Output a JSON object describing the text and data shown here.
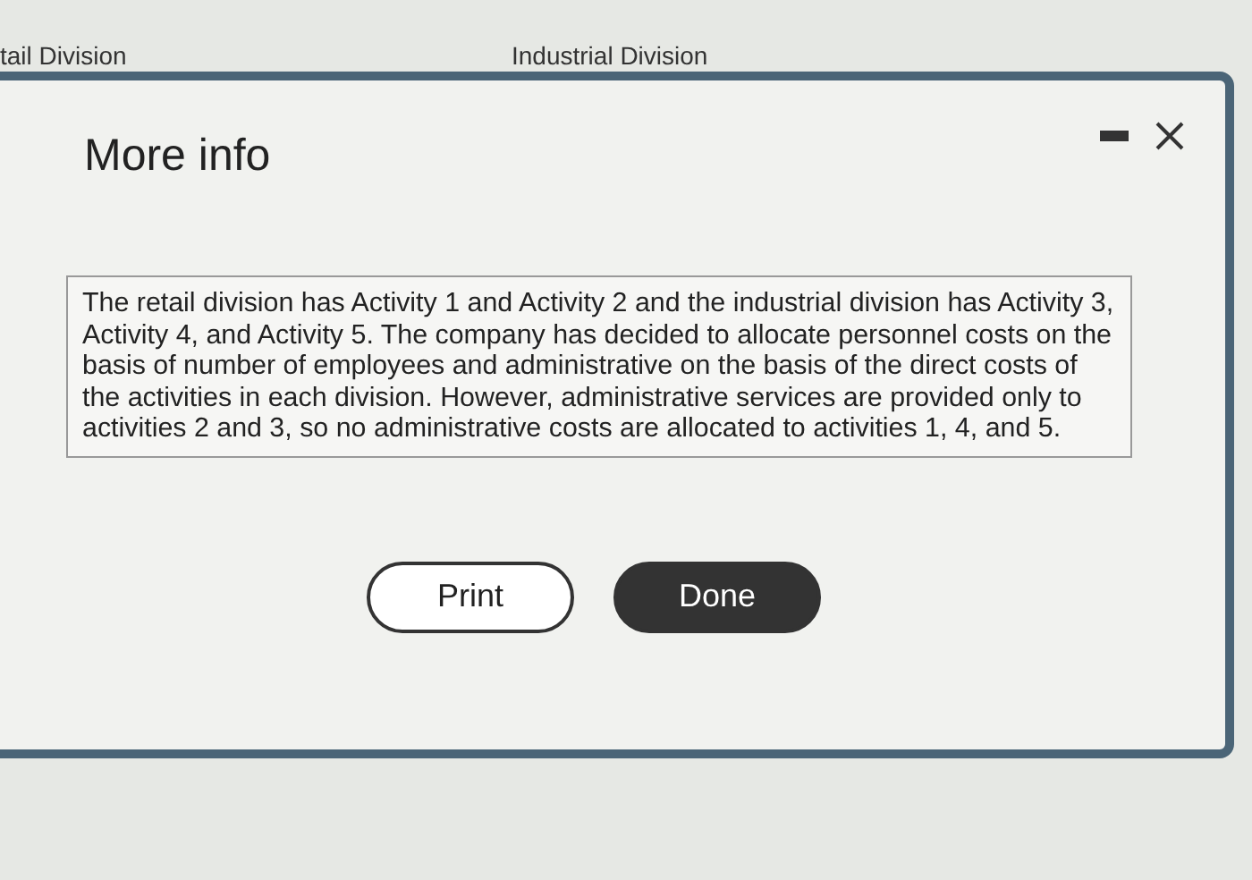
{
  "background": {
    "column_headers": [
      "tail Division",
      "Industrial Division"
    ]
  },
  "dialog": {
    "title": "More info",
    "body": "The retail division has Activity 1 and Activity 2 and the industrial division has Activity 3, Activity 4, and Activity 5. The company has decided to allocate personnel costs on the basis of number of employees and administrative on the basis of the direct costs of the activities in each division. However, administrative services are provided only to activities 2 and 3, so no administrative costs are allocated to activities 1, 4, and 5.",
    "buttons": [
      {
        "label": "Print",
        "kind": "outline"
      },
      {
        "label": "Done",
        "kind": "filled"
      }
    ]
  }
}
